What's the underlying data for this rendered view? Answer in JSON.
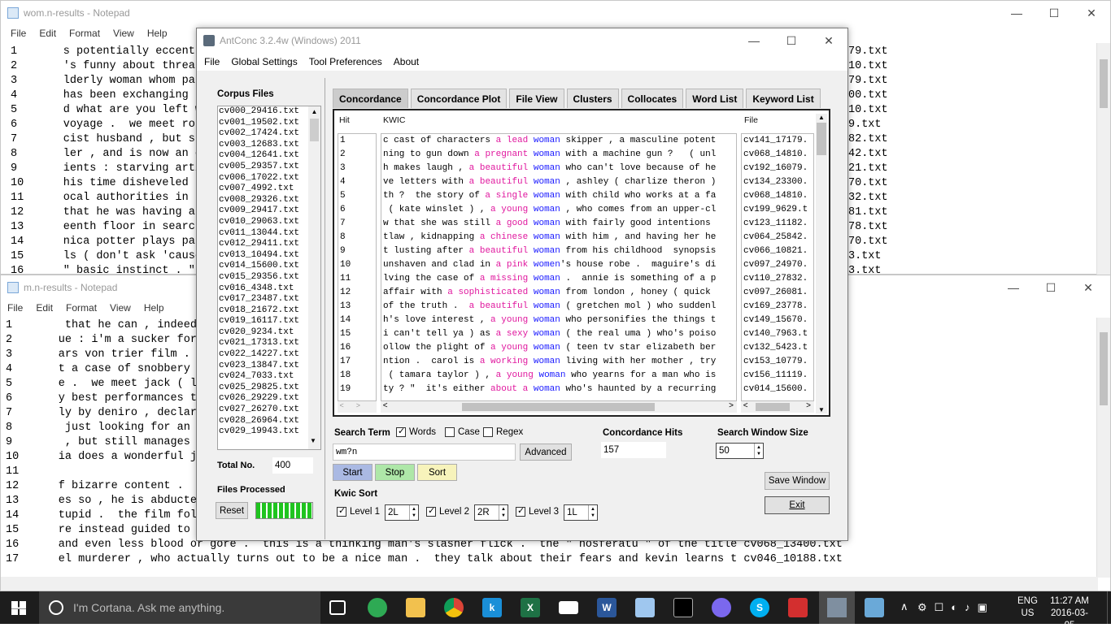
{
  "notepad1": {
    "title": "wom.n-results - Notepad",
    "menu": [
      "File",
      "Edit",
      "Format",
      "View",
      "Help"
    ],
    "lines": [
      "1       s potentially eccentr",
      "2       's funny about threat",
      "3       lderly woman whom pat",
      "4       has been exchanging l",
      "5       d what are you left w",
      "6       voyage .  we meet ros",
      "7       cist husband , but sh",
      "8       ler , and is now an o",
      "9       ients : starving arti",
      "10      his time disheveled ,",
      "11      ocal authorities in s",
      "12      that he was having an",
      "13      eenth floor in search",
      "14      nica potter plays pat",
      "15      ls ( don't ask 'cause",
      "16      \" basic instinct . \" "
    ],
    "right": [
      "79.txt",
      "10.txt",
      "79.txt",
      "00.txt",
      "10.txt",
      "9.txt",
      "82.txt",
      "42.txt",
      "21.txt",
      "70.txt",
      "32.txt",
      "81.txt",
      "78.txt",
      "70.txt",
      "3.txt",
      "3.txt"
    ]
  },
  "notepad2": {
    "title": "m.n-results - Notepad",
    "menu": [
      "File",
      "Edit",
      "Format",
      "View",
      "Help"
    ],
    "lines": [
      "1        that he can , indeed ",
      "2       ue : i'm a sucker for ",
      "3       ars von trier film . ",
      "4       t a case of snobbery ",
      "5       e .  we meet jack ( le",
      "6       y best performances th",
      "7       ly by deniro , declari",
      "8        just looking for an e",
      "9        , but still manages t",
      "10      ia does a wonderful jo",
      "11      ",
      "12      f bizarre content .  w",
      "13      es so , he is abducte",
      "14      tupid .  the film foll",
      "15      re instead guided to e",
      "16      and even less blood or gore .  this is a thinking man's slasher flick .  the \" nosferatu \" of the title cv068_13400.txt",
      "17      el murderer , who actually turns out to be a nice man .  they talk about their fears and kevin learns t cv046_10188.txt"
    ]
  },
  "antconc": {
    "title": "AntConc 3.2.4w (Windows) 2011",
    "menu": [
      "File",
      "Global Settings",
      "Tool Preferences",
      "About"
    ],
    "corpus_label": "Corpus Files",
    "files": [
      "cv000_29416.txt",
      "cv001_19502.txt",
      "cv002_17424.txt",
      "cv003_12683.txt",
      "cv004_12641.txt",
      "cv005_29357.txt",
      "cv006_17022.txt",
      "cv007_4992.txt",
      "cv008_29326.txt",
      "cv009_29417.txt",
      "cv010_29063.txt",
      "cv011_13044.txt",
      "cv012_29411.txt",
      "cv013_10494.txt",
      "cv014_15600.txt",
      "cv015_29356.txt",
      "cv016_4348.txt",
      "cv017_23487.txt",
      "cv018_21672.txt",
      "cv019_16117.txt",
      "cv020_9234.txt",
      "cv021_17313.txt",
      "cv022_14227.txt",
      "cv023_13847.txt",
      "cv024_7033.txt",
      "cv025_29825.txt",
      "cv026_29229.txt",
      "cv027_26270.txt",
      "cv028_26964.txt",
      "cv029_19943.txt"
    ],
    "total_label": "Total No.",
    "total": "400",
    "processed_label": "Files Processed",
    "reset": "Reset",
    "tabs": [
      "Concordance",
      "Concordance Plot",
      "File View",
      "Clusters",
      "Collocates",
      "Word List",
      "Keyword List"
    ],
    "col_hit": "Hit",
    "col_kwic": "KWIC",
    "col_file": "File",
    "rows": [
      {
        "n": "1",
        "a": "c cast of characters ",
        "b": "a",
        "c": " ",
        "d": "lead",
        "e": " ",
        "k": "woman",
        "r": " skipper , a masculine potent",
        "f": "cv141_17179."
      },
      {
        "n": "2",
        "a": "ning to gun down ",
        "b": "a",
        "c": " ",
        "d": "pregnant",
        "e": " ",
        "k": "woman",
        "r": " with a machine gun ?   ( unl",
        "f": "cv068_14810."
      },
      {
        "n": "3",
        "a": "h makes laugh , ",
        "b": "a",
        "c": " ",
        "d": "beautiful",
        "e": " ",
        "k": "woman",
        "r": " who can't love because of he",
        "f": "cv192_16079."
      },
      {
        "n": "4",
        "a": "ve letters with ",
        "b": "a",
        "c": " ",
        "d": "beautiful",
        "e": " ",
        "k": "woman",
        "r": " , ashley ( charlize theron )",
        "f": "cv134_23300."
      },
      {
        "n": "5",
        "a": "th ?  the story of ",
        "b": "a",
        "c": " ",
        "d": "single",
        "e": " ",
        "k": "woman",
        "r": " with child who works at a fa",
        "f": "cv068_14810."
      },
      {
        "n": "6",
        "a": " ( kate winslet ) , ",
        "b": "a",
        "c": " ",
        "d": "young",
        "e": " ",
        "k": "woman",
        "r": " , who comes from an upper-cl",
        "f": "cv199_9629.t"
      },
      {
        "n": "7",
        "a": "w that she was still ",
        "b": "a",
        "c": " ",
        "d": "good",
        "e": " ",
        "k": "woman",
        "r": " with fairly good intentions ",
        "f": "cv123_11182."
      },
      {
        "n": "8",
        "a": "tlaw , kidnapping ",
        "b": "a",
        "c": " ",
        "d": "chinese",
        "e": " ",
        "k": "woman",
        "r": " with him , and having her he",
        "f": "cv064_25842."
      },
      {
        "n": "9",
        "a": "t lusting after ",
        "b": "a",
        "c": " ",
        "d": "beautiful",
        "e": " ",
        "k": "woman",
        "r": " from his childhood  synopsis",
        "f": "cv066_10821."
      },
      {
        "n": "10",
        "a": "unshaven and clad in ",
        "b": "a",
        "c": " ",
        "d": "pink",
        "e": " ",
        "k": "women",
        "r": "'s house robe .  maguire's di",
        "f": "cv097_24970."
      },
      {
        "n": "11",
        "a": "lving the case of ",
        "b": "a",
        "c": " ",
        "d": "missing",
        "e": " ",
        "k": "woman",
        "r": " .  annie is something of a p",
        "f": "cv110_27832."
      },
      {
        "n": "12",
        "a": "affair with ",
        "b": "a",
        "c": " ",
        "d": "sophisticated",
        "e": " ",
        "k": "woman",
        "r": " from london , honey ( quick ",
        "f": "cv097_26081."
      },
      {
        "n": "13",
        "a": "of the truth .  ",
        "b": "a",
        "c": " ",
        "d": "beautiful",
        "e": " ",
        "k": "woman",
        "r": " ( gretchen mol ) who suddenl",
        "f": "cv169_23778."
      },
      {
        "n": "14",
        "a": "h's love interest , ",
        "b": "a",
        "c": " ",
        "d": "young",
        "e": " ",
        "k": "woman",
        "r": " who personifies the things t",
        "f": "cv149_15670."
      },
      {
        "n": "15",
        "a": "i can't tell ya ) as ",
        "b": "a",
        "c": " ",
        "d": "sexy",
        "e": " ",
        "k": "woman",
        "r": " ( the real uma ) who's poiso",
        "f": "cv140_7963.t"
      },
      {
        "n": "16",
        "a": "ollow the plight of ",
        "b": "a",
        "c": " ",
        "d": "young",
        "e": " ",
        "k": "woman",
        "r": " ( teen tv star elizabeth ber",
        "f": "cv132_5423.t"
      },
      {
        "n": "17",
        "a": "ntion .  carol is ",
        "b": "a",
        "c": " ",
        "d": "working",
        "e": " ",
        "k": "woman",
        "r": " living with her mother , try",
        "f": "cv153_10779."
      },
      {
        "n": "18",
        "a": " ( tamara taylor ) , ",
        "b": "a",
        "c": " ",
        "d": "young",
        "e": " ",
        "k": "woman",
        "r": " who yearns for a man who is ",
        "f": "cv156_11119."
      },
      {
        "n": "19",
        "a": "ty ? \"  it's either ",
        "b": "about",
        "c": " ",
        "d": "a",
        "e": " ",
        "k": "woman",
        "r": " who's haunted by a recurring",
        "f": "cv014_15600."
      }
    ],
    "search_term_label": "Search Term",
    "words": "Words",
    "case": "Case",
    "regex": "Regex",
    "search_value": "wm?n",
    "advanced": "Advanced",
    "start": "Start",
    "stop": "Stop",
    "sort": "Sort",
    "hits_label": "Concordance Hits",
    "hits": "157",
    "window_label": "Search Window Size",
    "window": "50",
    "save_window": "Save Window",
    "exit": "Exit",
    "kwic_sort": "Kwic Sort",
    "level1": "Level 1",
    "level1_val": "2L",
    "level2": "Level 2",
    "level2_val": "2R",
    "level3": "Level 3",
    "level3_val": "1L"
  },
  "taskbar": {
    "cortana": "I'm Cortana. Ask me anything.",
    "lang1": "ENG",
    "lang2": "US",
    "time": "11:27 AM",
    "date": "2016-03-05"
  }
}
